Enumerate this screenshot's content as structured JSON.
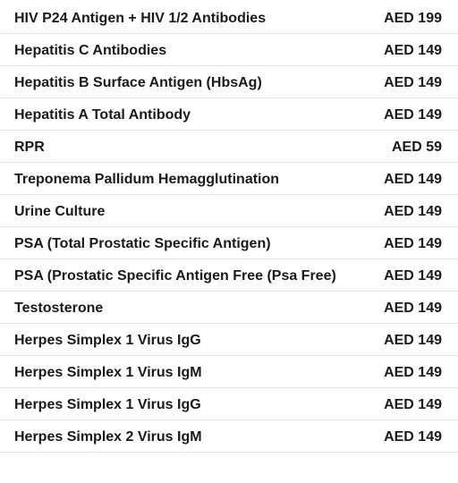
{
  "price_list": {
    "rows": [
      {
        "name": "HIV P24 Antigen + HIV 1/2 Antibodies",
        "price": "AED 199"
      },
      {
        "name": "Hepatitis C Antibodies",
        "price": "AED 149"
      },
      {
        "name": "Hepatitis B Surface Antigen (HbsAg)",
        "price": "AED 149"
      },
      {
        "name": "Hepatitis A Total Antibody",
        "price": "AED 149"
      },
      {
        "name": "RPR",
        "price": "AED 59"
      },
      {
        "name": "Treponema Pallidum Hemagglutination",
        "price": "AED 149"
      },
      {
        "name": "Urine Culture",
        "price": "AED 149"
      },
      {
        "name": "PSA (Total Prostatic Specific Antigen)",
        "price": "AED 149"
      },
      {
        "name": "PSA (Prostatic Specific Antigen Free (Psa Free)",
        "price": "AED 149"
      },
      {
        "name": "Testosterone",
        "price": "AED 149"
      },
      {
        "name": "Herpes Simplex 1 Virus IgG",
        "price": "AED 149"
      },
      {
        "name": "Herpes Simplex 1 Virus IgM",
        "price": "AED 149"
      },
      {
        "name": "Herpes Simplex 1 Virus IgG",
        "price": "AED 149"
      },
      {
        "name": "Herpes Simplex 2 Virus IgM",
        "price": "AED 149"
      }
    ]
  }
}
